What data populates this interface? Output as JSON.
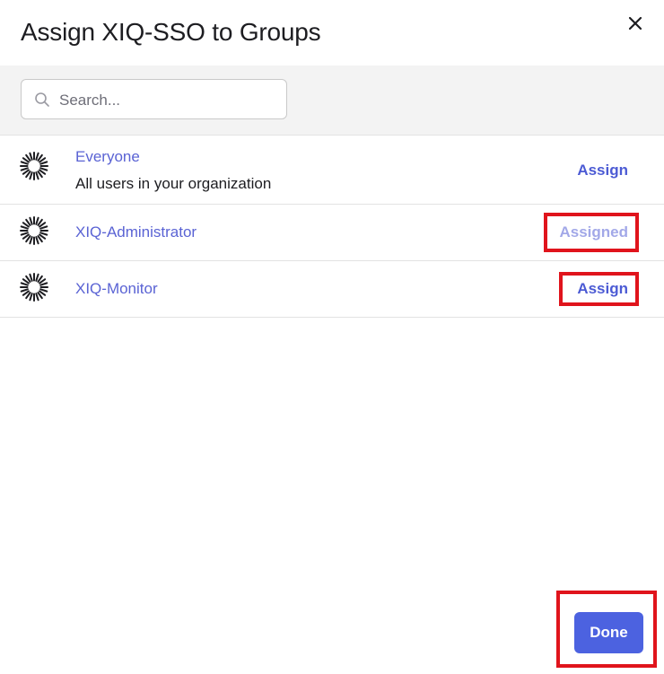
{
  "dialog": {
    "title": "Assign XIQ-SSO to Groups",
    "close_icon": "close-icon"
  },
  "search": {
    "placeholder": "Search...",
    "value": "",
    "icon": "search-icon"
  },
  "groups": [
    {
      "name": "Everyone",
      "description": "All users in your organization",
      "action": "Assign",
      "state": "unassigned",
      "icon": "group-icon"
    },
    {
      "name": "XIQ-Administrator",
      "description": "",
      "action": "Assigned",
      "state": "assigned",
      "icon": "group-icon"
    },
    {
      "name": "XIQ-Monitor",
      "description": "",
      "action": "Assign",
      "state": "unassigned",
      "icon": "group-icon"
    }
  ],
  "footer": {
    "done_label": "Done"
  },
  "colors": {
    "accent": "#4c62e0",
    "link": "#5a63d4",
    "assigned": "#a2a8e8",
    "highlight": "#e0141c"
  }
}
